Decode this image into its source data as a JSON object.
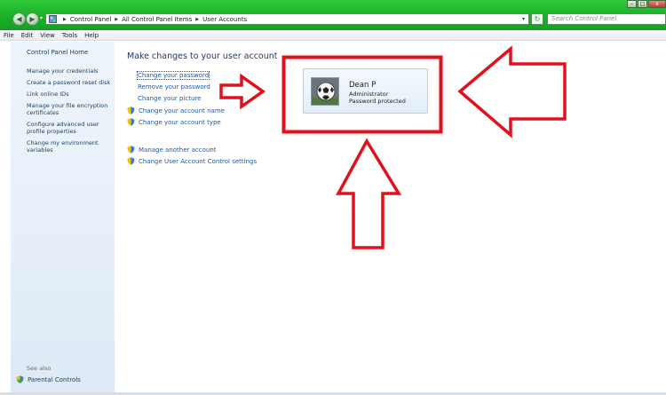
{
  "window": {
    "breadcrumbs": [
      "Control Panel",
      "All Control Panel Items",
      "User Accounts"
    ],
    "search_placeholder": "Search Control Panel",
    "controls": {
      "minimize": "–",
      "maximize": "□",
      "close": "x"
    }
  },
  "menu": [
    "File",
    "Edit",
    "View",
    "Tools",
    "Help"
  ],
  "left_pane": {
    "home": "Control Panel Home",
    "tasks": [
      "Manage your credentials",
      "Create a password reset disk",
      "Link online IDs",
      "Manage your file encryption certificates",
      "Configure advanced user profile properties",
      "Change my environment variables"
    ],
    "see_also": "See also",
    "parental_controls": "Parental Controls"
  },
  "main": {
    "heading": "Make changes to your user account",
    "links": {
      "change_password": "Change your password",
      "remove_password": "Remove your password",
      "change_picture": "Change your picture",
      "change_name": "Change your account name",
      "change_type": "Change your account type",
      "manage_another": "Manage another account",
      "uac_settings": "Change User Account Control settings"
    },
    "user": {
      "name": "Dean P",
      "role": "Administrator",
      "status": "Password protected",
      "avatar_icon": "soccer-ball-icon"
    }
  },
  "colors": {
    "aero_green": "#1db52a",
    "link_blue": "#1e5aa8",
    "annotation_red": "#e0101c"
  }
}
